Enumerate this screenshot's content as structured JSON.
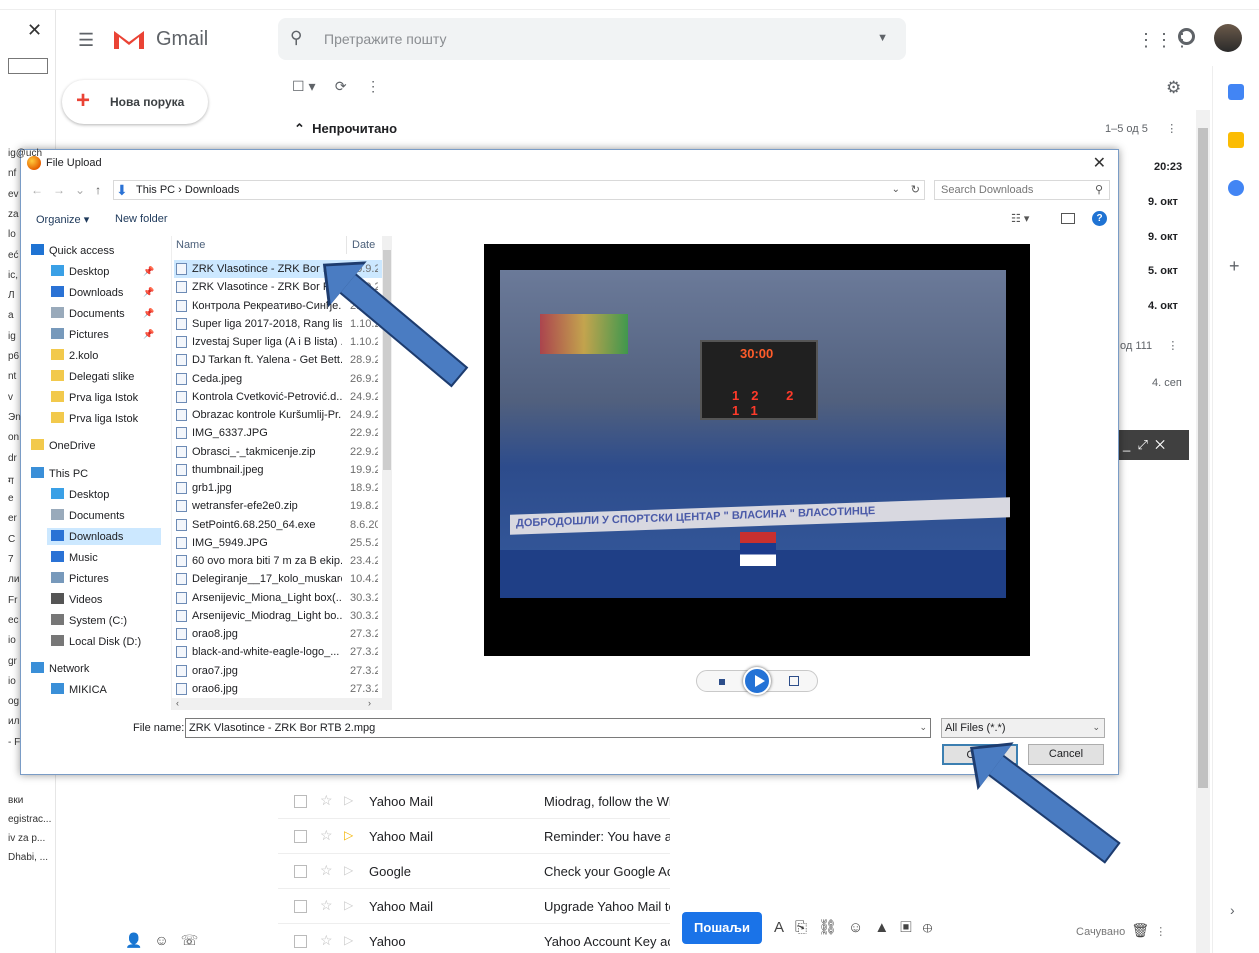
{
  "gmail": {
    "app_name": "Gmail",
    "search_placeholder": "Претражите пошту",
    "compose_label": "Нова порука",
    "section_title": "Непрочитано",
    "pager_top": "1–5 од 5",
    "pager_mid": "од 111",
    "dates": [
      "20:23",
      "9. окт",
      "9. окт",
      "5. окт",
      "4. окт"
    ],
    "date_other": "4. сеп",
    "left_frags": [
      "ig@uch",
      "nf",
      "ev",
      "za",
      "lo",
      "eć",
      "ic,",
      "Л",
      "a",
      "ig",
      "p6",
      "nt",
      "v",
      "Эn",
      "on",
      "dr",
      "ग",
      "e",
      "er",
      "C",
      "7",
      "ли",
      "Fr",
      "ec",
      "io",
      "gr",
      "io",
      "og",
      "ил",
      "- F"
    ],
    "left_snips": [
      "вки",
      "egistrac...",
      "iv za p...",
      "Dhabi, ..."
    ],
    "mail_rows": [
      {
        "sender": "Yahoo Mail",
        "subject": "Miodrag, follow the Wi"
      },
      {
        "sender": "Yahoo Mail",
        "subject": "Reminder: You have ar"
      },
      {
        "sender": "Google",
        "subject": "Check your Google Acc"
      },
      {
        "sender": "Yahoo Mail",
        "subject": "Upgrade Yahoo Mail to"
      },
      {
        "sender": "Yahoo",
        "subject": "Yahoo Account Key ac"
      }
    ],
    "send_label": "Пошаљи",
    "saved_label": "Сачувано"
  },
  "dialog": {
    "title": "File Upload",
    "breadcrumb": "This PC  ›  Downloads",
    "search_placeholder": "Search Downloads",
    "organize_label": "Organize ▾",
    "new_folder_label": "New folder",
    "nav_items": [
      {
        "label": "Quick access",
        "pinned": false
      },
      {
        "label": "Desktop",
        "pinned": true
      },
      {
        "label": "Downloads",
        "pinned": true
      },
      {
        "label": "Documents",
        "pinned": true
      },
      {
        "label": "Pictures",
        "pinned": true
      },
      {
        "label": "2.kolo",
        "pinned": false
      },
      {
        "label": "Delegati slike",
        "pinned": false
      },
      {
        "label": "Prva liga Istok",
        "pinned": false
      },
      {
        "label": "Prva liga Istok",
        "pinned": false
      },
      {
        "label": "OneDrive",
        "pinned": false
      },
      {
        "label": "This PC",
        "pinned": false
      },
      {
        "label": "Desktop",
        "pinned": false
      },
      {
        "label": "Documents",
        "pinned": false
      },
      {
        "label": "Downloads",
        "pinned": false
      },
      {
        "label": "Music",
        "pinned": false
      },
      {
        "label": "Pictures",
        "pinned": false
      },
      {
        "label": "Videos",
        "pinned": false
      },
      {
        "label": "System (C:)",
        "pinned": false
      },
      {
        "label": "Local Disk (D:)",
        "pinned": false
      },
      {
        "label": "Network",
        "pinned": false
      },
      {
        "label": "MIKICA",
        "pinned": false
      }
    ],
    "col_name": "Name",
    "col_date": "Date",
    "files": [
      {
        "name": "ZRK Vlasotince - ZRK Bor RTB ...",
        "date": "20.9.2"
      },
      {
        "name": "ZRK Vlasotince - ZRK Bor RTB ...",
        "date": "20.9.2"
      },
      {
        "name": "Контрола Рекреативо-Синђе...",
        "date": "2.10.2"
      },
      {
        "name": "Super liga 2017-2018, Rang list...",
        "date": "1.10.2"
      },
      {
        "name": "Izvestaj Super liga (A i B lista) ...",
        "date": "1.10.2"
      },
      {
        "name": "DJ Tarkan ft. Yalena - Get Bett...",
        "date": "28.9.2"
      },
      {
        "name": "Ceda.jpeg",
        "date": "26.9.2"
      },
      {
        "name": "Kontrola Cvetković-Petrović.d...",
        "date": "24.9.2"
      },
      {
        "name": "Obrazac kontrole Kuršumlij-Pr...",
        "date": "24.9.2"
      },
      {
        "name": "IMG_6337.JPG",
        "date": "22.9.2"
      },
      {
        "name": "Obrasci_-_takmicenje.zip",
        "date": "22.9.2"
      },
      {
        "name": "thumbnail.jpeg",
        "date": "19.9.2"
      },
      {
        "name": "grb1.jpg",
        "date": "18.9.2"
      },
      {
        "name": "wetransfer-efe2e0.zip",
        "date": "19.8.2"
      },
      {
        "name": "SetPoint6.68.250_64.exe",
        "date": "8.6.20"
      },
      {
        "name": "IMG_5949.JPG",
        "date": "25.5.2"
      },
      {
        "name": "60 ovo mora biti 7 m za B ekip...",
        "date": "23.4.2"
      },
      {
        "name": "Delegiranje__17_kolo_muskarc...",
        "date": "10.4.2"
      },
      {
        "name": "Arsenijevic_Miona_Light box(...",
        "date": "30.3.2"
      },
      {
        "name": "Arsenijevic_Miodrag_Light bo...",
        "date": "30.3.2"
      },
      {
        "name": "orao8.jpg",
        "date": "27.3.2"
      },
      {
        "name": "black-and-white-eagle-logo_...",
        "date": "27.3.2"
      },
      {
        "name": "orao7.jpg",
        "date": "27.3.2"
      },
      {
        "name": "orao6.jpg",
        "date": "27.3.2"
      }
    ],
    "preview": {
      "scoreboard_time": "30:00",
      "score": "12 2 11",
      "banner": "ДОБРОДОШЛИ У СПОРТСКИ ЦЕНТАР \" ВЛАСИНА \" ВЛАСОТИНЦЕ"
    },
    "filename_label": "File name:",
    "filename_value": "ZRK Vlasotince - ZRK Bor RTB 2.mpg",
    "filter_value": "All Files (*.*)",
    "open_label": "Open",
    "cancel_label": "Cancel"
  },
  "colors": {
    "gmail_red": "#ea4335",
    "send_blue": "#1a73e8",
    "arrow_blue": "#4a7cc2"
  }
}
